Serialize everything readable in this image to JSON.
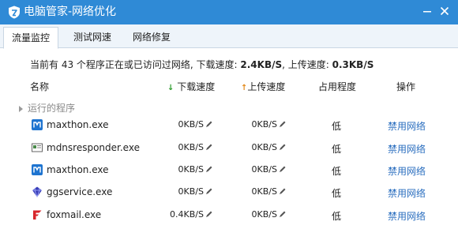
{
  "window": {
    "title": "电脑管家-网络优化",
    "minimize_icon": "minimize-icon",
    "close_icon": "close-icon",
    "logo_icon": "shield-logo-icon",
    "titlebar_color": "#2f8ad6"
  },
  "tabs": [
    {
      "label": "流量监控",
      "active": true
    },
    {
      "label": "测试网速",
      "active": false
    },
    {
      "label": "网络修复",
      "active": false
    }
  ],
  "summary": {
    "prefix": "当前有 43 个程序正在或已访问过网络, 下载速度: ",
    "download_speed": "2.4KB/S",
    "middle": ", 上传速度: ",
    "upload_speed": "0.3KB/S"
  },
  "headers": {
    "name": "名称",
    "download": "下载速度",
    "upload": "上传速度",
    "usage": "占用程度",
    "operation": "操作"
  },
  "group": {
    "label": "运行的程序"
  },
  "rows": [
    {
      "name": "maxthon.exe",
      "icon": "maxthon-icon",
      "download": "0KB/S",
      "upload": "0KB/S",
      "usage": "低",
      "action": "禁用网络"
    },
    {
      "name": "mdnsresponder.exe",
      "icon": "mdnsresponder-icon",
      "download": "0KB/S",
      "upload": "0KB/S",
      "usage": "低",
      "action": "禁用网络"
    },
    {
      "name": "maxthon.exe",
      "icon": "maxthon-icon",
      "download": "0KB/S",
      "upload": "0KB/S",
      "usage": "低",
      "action": "禁用网络"
    },
    {
      "name": "ggservice.exe",
      "icon": "ggservice-icon",
      "download": "0KB/S",
      "upload": "0KB/S",
      "usage": "低",
      "action": "禁用网络"
    },
    {
      "name": "foxmail.exe",
      "icon": "foxmail-icon",
      "download": "0.4KB/S",
      "upload": "0KB/S",
      "usage": "低",
      "action": "禁用网络"
    }
  ],
  "colors": {
    "link": "#2a6ebf",
    "download_arrow": "#2a9b2a",
    "upload_arrow": "#e38a1a"
  }
}
